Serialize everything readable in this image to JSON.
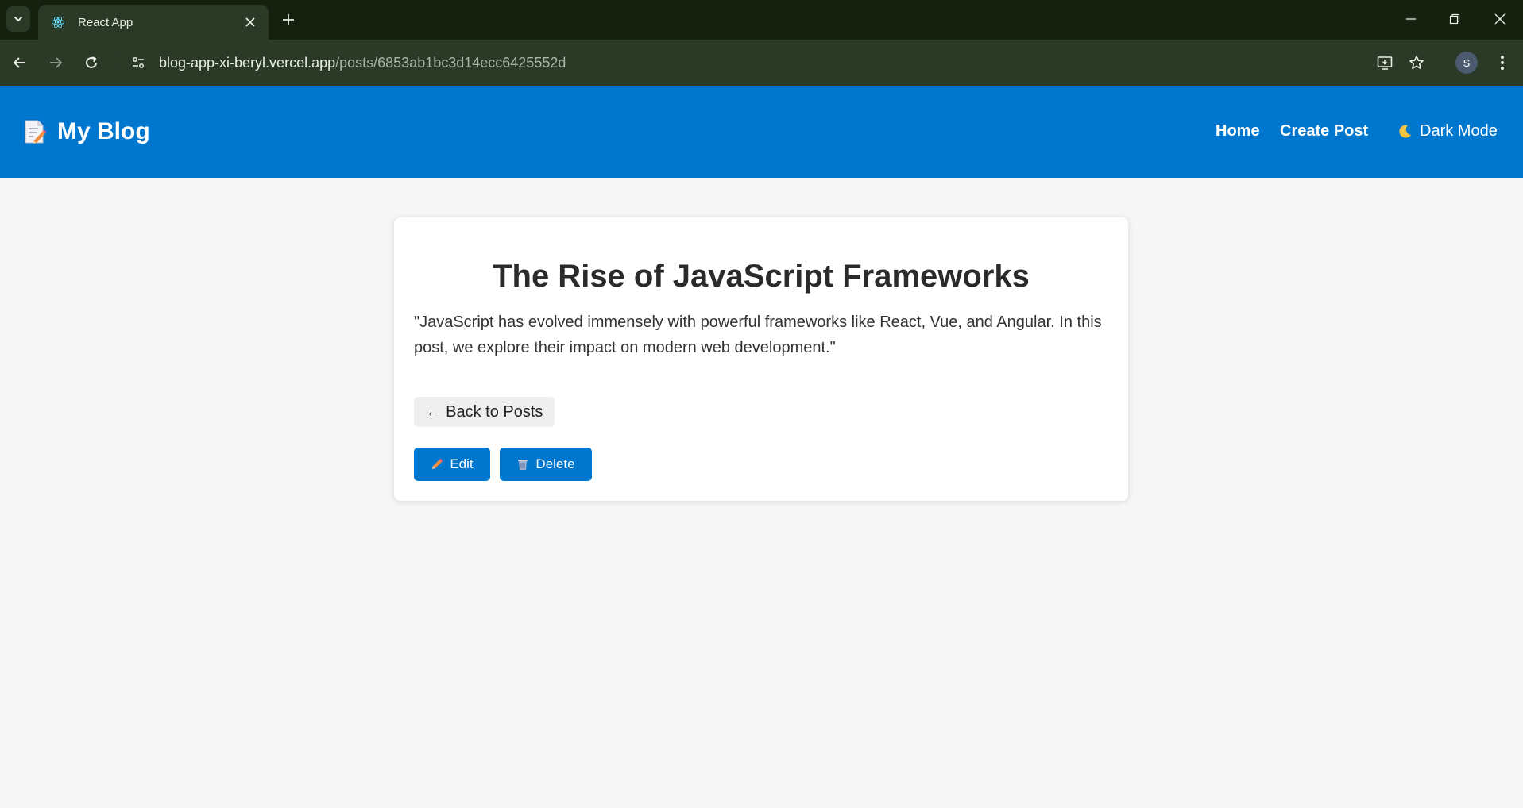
{
  "browser": {
    "tab_title": "React App",
    "url_host": "blog-app-xi-beryl.vercel.app",
    "url_path": "/posts/6853ab1bc3d14ecc6425552d",
    "profile_initial": "S"
  },
  "header": {
    "brand_emoji": "📝",
    "brand_title": "My Blog",
    "nav": {
      "home": "Home",
      "create_post": "Create Post",
      "dark_mode": "Dark Mode"
    }
  },
  "post": {
    "title": "The Rise of JavaScript Frameworks",
    "body": "\"JavaScript has evolved immensely with powerful frameworks like React, Vue, and Angular. In this post, we explore their impact on modern web development.\"",
    "back_label": "← Back to Posts",
    "edit_label": "Edit",
    "delete_label": "Delete"
  },
  "colors": {
    "header_bg": "#0077cf",
    "button_bg": "#0077cf",
    "page_bg": "#f6f6f6",
    "chrome_dark": "#15200f",
    "chrome_toolbar": "#2b3a27"
  },
  "icons": {
    "tab_favicon": "react-logo-icon",
    "brand": "memo-icon",
    "dark_mode": "crescent-moon-icon",
    "edit": "pencil-icon",
    "delete": "wastebasket-icon"
  }
}
